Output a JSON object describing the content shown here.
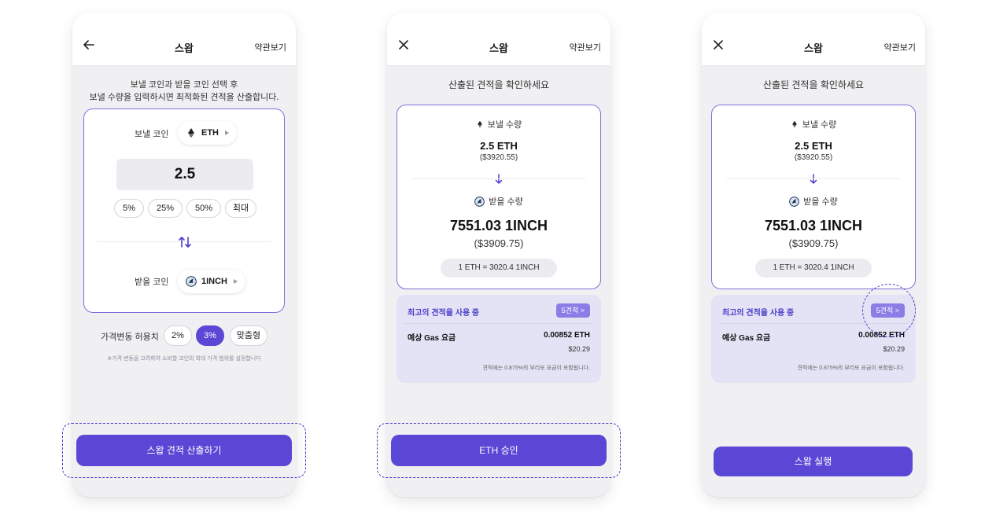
{
  "colors": {
    "accent": "#5a47d6",
    "accent_light": "#8a7ee6",
    "border_purple": "#7b72d9",
    "info_bg": "#e3e3f5",
    "screen_bg": "#f0f0f3"
  },
  "screen1": {
    "header": {
      "back_icon": "arrow-left-icon",
      "title": "스왑",
      "terms": "약관보기"
    },
    "intro_line1": "보낼 코인과 받을 코인 선택 후",
    "intro_line2": "보낼 수량을 입력하시면 최적화된 견적을 산출합니다.",
    "send_label": "보낼 코인",
    "send_coin": {
      "icon": "ethereum-icon",
      "symbol": "ETH"
    },
    "amount": "2.5",
    "percent_chips": [
      "5%",
      "25%",
      "50%",
      "최대"
    ],
    "swap_icon": "swap-arrows-icon",
    "receive_label": "받을 코인",
    "receive_coin": {
      "icon": "1inch-icon",
      "symbol": "1INCH"
    },
    "slippage_label": "가격변동 허용치",
    "slippage_options": [
      "2%",
      "3%",
      "맞춤형"
    ],
    "slippage_selected": "3%",
    "slippage_note": "※가격 변동을 고려하여 소비할 코인의 최대 가격 범위를 설정합니다",
    "cta": "스왑 견적 산출하기"
  },
  "screen2": {
    "header": {
      "close_icon": "close-icon",
      "title": "스왑",
      "terms": "약관보기"
    },
    "intro": "산출된 견적을 확인하세요",
    "send_label": "보낼 수량",
    "send_amount": "2.5 ETH",
    "send_usd": "($3920.55)",
    "receive_label": "받을 수량",
    "receive_amount": "7551.03 1INCH",
    "receive_usd": "($3909.75)",
    "rate": "1 ETH = 3020.4  1INCH",
    "best_quote": "최고의 견적을 사용 중",
    "quotes_button": "5견적 >",
    "gas_label": "예상 Gas 요금",
    "gas_eth": "0.00852 ETH",
    "gas_usd": "$20.29",
    "fee_note": "견적에는 0.875%의 부리또 요금이 포함됩니다.",
    "cta": "ETH 승인"
  },
  "screen3": {
    "header": {
      "close_icon": "close-icon",
      "title": "스왑",
      "terms": "약관보기"
    },
    "intro": "산출된 견적을 확인하세요",
    "send_label": "보낼 수량",
    "send_amount": "2.5 ETH",
    "send_usd": "($3920.55)",
    "receive_label": "받을 수량",
    "receive_amount": "7551.03 1INCH",
    "receive_usd": "($3909.75)",
    "rate": "1 ETH = 3020.4  1INCH",
    "best_quote": "최고의 견적을 사용 중",
    "quotes_button": "5견적 >",
    "gas_label": "예상 Gas 요금",
    "gas_eth": "0.00852 ETH",
    "gas_usd": "$20.29",
    "fee_note": "견적에는 0.875%의 부리또 요금이 포함됩니다.",
    "cta": "스왑 실행"
  }
}
